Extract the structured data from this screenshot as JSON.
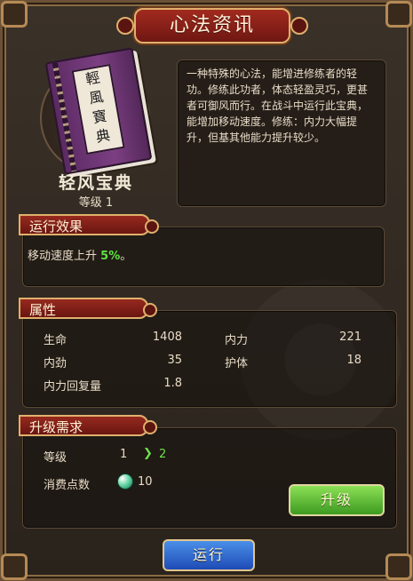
{
  "window": {
    "title": "心法资讯"
  },
  "item": {
    "name": "轻风宝典",
    "level_text": "等级 1",
    "book_title_glyphs": [
      "輕",
      "風",
      "寶",
      "典"
    ],
    "description": "一种特殊的心法，能增进修练者的轻功。修练此功者，体态轻盈灵巧，更甚者可御风而行。在战斗中运行此宝典，能增加移动速度。修练：内力大幅提升，但基其他能力提升较少。"
  },
  "sections": {
    "effect": {
      "label": "运行效果",
      "text_prefix": "移动速度上升",
      "value": "5%",
      "text_suffix": "。"
    },
    "attributes": {
      "label": "属性",
      "rows": [
        {
          "label": "生命",
          "value": "1408"
        },
        {
          "label": "内力",
          "value": "221"
        },
        {
          "label": "内劲",
          "value": "35"
        },
        {
          "label": "护体",
          "value": "18"
        },
        {
          "label": "内力回复量",
          "value": "1.8"
        }
      ]
    },
    "upgrade": {
      "label": "升级需求",
      "level_label": "等级",
      "level_current": "1",
      "level_next": "2",
      "arrow_icon": "chevron-right",
      "cost_label": "消费点数",
      "cost_value": "10",
      "cost_icon": "gem"
    }
  },
  "buttons": {
    "upgrade": "升级",
    "run": "运行"
  },
  "colors": {
    "title_bg": "#8c2318",
    "panel_text": "#e9dcc7",
    "highlight_green": "#5fe142",
    "upgrade_btn": "#63c53a",
    "run_btn": "#2f6ad2",
    "gold_border": "#e0b06d"
  }
}
